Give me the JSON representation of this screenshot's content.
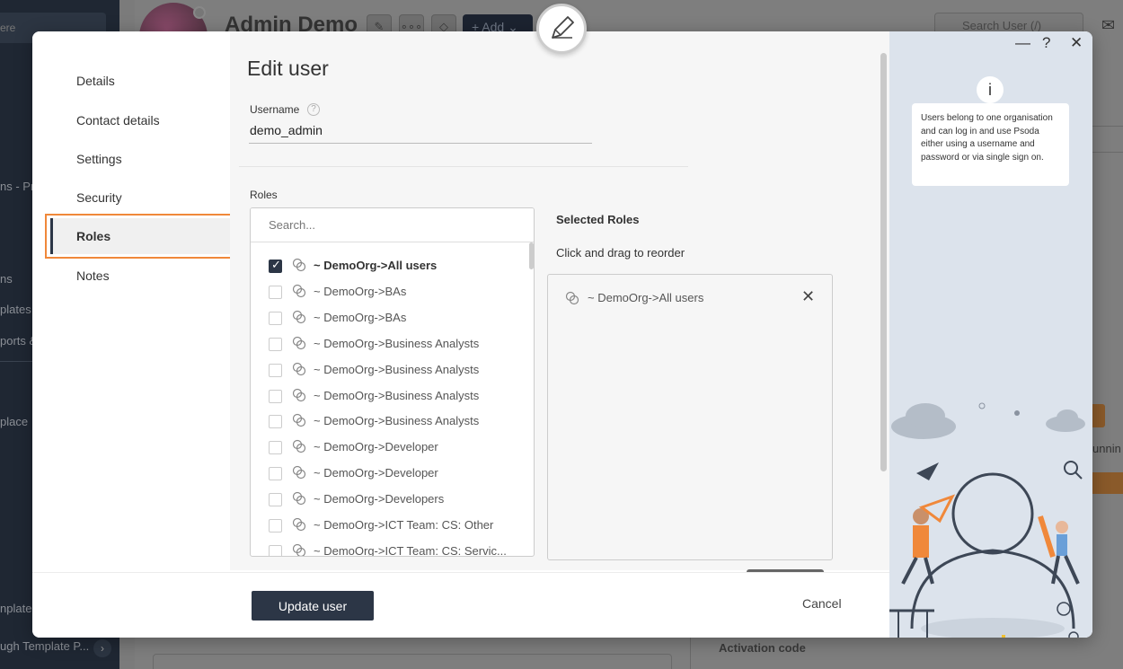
{
  "background": {
    "sidebar_search": "ere",
    "sidebar_items": [
      "ns - Pro",
      "ns",
      "plates",
      "ports &",
      "place",
      "nplate C",
      "ugh Template P..."
    ],
    "title": "Admin Demo",
    "add_label": "Add",
    "search_placeholder": "Search User (/)",
    "running_text": "unnin",
    "activation_label": "Activation code"
  },
  "modal": {
    "nav": [
      {
        "label": "Details"
      },
      {
        "label": "Contact details"
      },
      {
        "label": "Settings"
      },
      {
        "label": "Security"
      },
      {
        "label": "Roles",
        "active": true
      },
      {
        "label": "Notes"
      }
    ],
    "title": "Edit user",
    "username_label": "Username",
    "help_glyph": "?",
    "username_value": "demo_admin",
    "roles_label": "Roles",
    "roles_search_placeholder": "Search...",
    "roles": [
      {
        "label": "~ DemoOrg->All users",
        "checked": true
      },
      {
        "label": "~ DemoOrg->BAs",
        "checked": false
      },
      {
        "label": "~ DemoOrg->BAs",
        "checked": false
      },
      {
        "label": "~ DemoOrg->Business Analysts",
        "checked": false
      },
      {
        "label": "~ DemoOrg->Business Analysts",
        "checked": false
      },
      {
        "label": "~ DemoOrg->Business Analysts",
        "checked": false
      },
      {
        "label": "~ DemoOrg->Business Analysts",
        "checked": false
      },
      {
        "label": "~ DemoOrg->Developer",
        "checked": false
      },
      {
        "label": "~ DemoOrg->Developer",
        "checked": false
      },
      {
        "label": "~ DemoOrg->Developers",
        "checked": false
      },
      {
        "label": "~ DemoOrg->ICT Team: CS: Other",
        "checked": false
      },
      {
        "label": "~ DemoOrg->ICT Team: CS: Servic...",
        "checked": false
      }
    ],
    "selected_title": "Selected Roles",
    "selected_hint": "Click and drag to reorder",
    "selected_roles": [
      {
        "label": "~ DemoOrg->All users"
      }
    ],
    "update_button": "Update user",
    "cancel_button": "Cancel",
    "info_text": "Users belong to one organisation and can log in and use Psoda either using a username and password or via single sign on.",
    "info_glyph": "i",
    "window_controls": {
      "minimize": "—",
      "help": "?",
      "close": "✕"
    }
  },
  "colors": {
    "primary": "#2c3646",
    "accent_orange": "#f0883a",
    "panel_blue": "#dce3ec"
  }
}
